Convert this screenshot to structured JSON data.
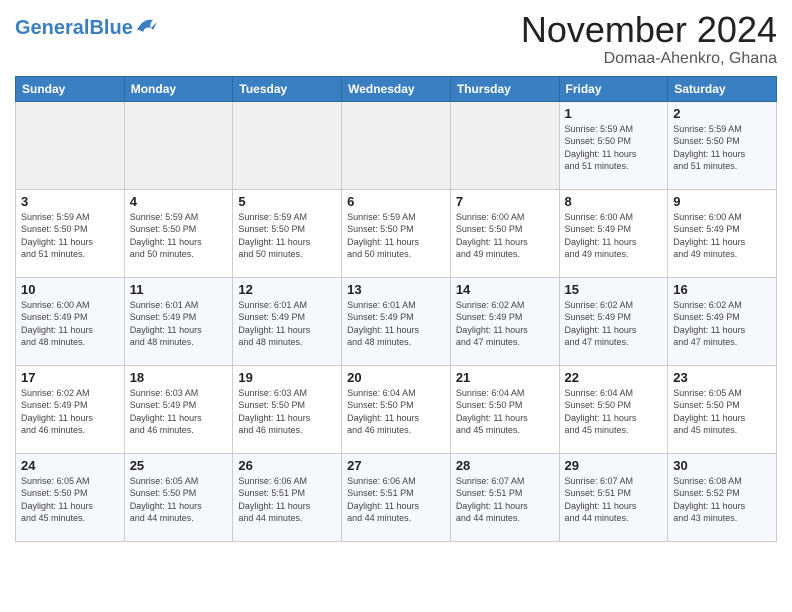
{
  "header": {
    "logo_general": "General",
    "logo_blue": "Blue",
    "month": "November 2024",
    "location": "Domaa-Ahenkro, Ghana"
  },
  "weekdays": [
    "Sunday",
    "Monday",
    "Tuesday",
    "Wednesday",
    "Thursday",
    "Friday",
    "Saturday"
  ],
  "weeks": [
    [
      {
        "day": "",
        "info": ""
      },
      {
        "day": "",
        "info": ""
      },
      {
        "day": "",
        "info": ""
      },
      {
        "day": "",
        "info": ""
      },
      {
        "day": "",
        "info": ""
      },
      {
        "day": "1",
        "info": "Sunrise: 5:59 AM\nSunset: 5:50 PM\nDaylight: 11 hours\nand 51 minutes."
      },
      {
        "day": "2",
        "info": "Sunrise: 5:59 AM\nSunset: 5:50 PM\nDaylight: 11 hours\nand 51 minutes."
      }
    ],
    [
      {
        "day": "3",
        "info": "Sunrise: 5:59 AM\nSunset: 5:50 PM\nDaylight: 11 hours\nand 51 minutes."
      },
      {
        "day": "4",
        "info": "Sunrise: 5:59 AM\nSunset: 5:50 PM\nDaylight: 11 hours\nand 50 minutes."
      },
      {
        "day": "5",
        "info": "Sunrise: 5:59 AM\nSunset: 5:50 PM\nDaylight: 11 hours\nand 50 minutes."
      },
      {
        "day": "6",
        "info": "Sunrise: 5:59 AM\nSunset: 5:50 PM\nDaylight: 11 hours\nand 50 minutes."
      },
      {
        "day": "7",
        "info": "Sunrise: 6:00 AM\nSunset: 5:50 PM\nDaylight: 11 hours\nand 49 minutes."
      },
      {
        "day": "8",
        "info": "Sunrise: 6:00 AM\nSunset: 5:49 PM\nDaylight: 11 hours\nand 49 minutes."
      },
      {
        "day": "9",
        "info": "Sunrise: 6:00 AM\nSunset: 5:49 PM\nDaylight: 11 hours\nand 49 minutes."
      }
    ],
    [
      {
        "day": "10",
        "info": "Sunrise: 6:00 AM\nSunset: 5:49 PM\nDaylight: 11 hours\nand 48 minutes."
      },
      {
        "day": "11",
        "info": "Sunrise: 6:01 AM\nSunset: 5:49 PM\nDaylight: 11 hours\nand 48 minutes."
      },
      {
        "day": "12",
        "info": "Sunrise: 6:01 AM\nSunset: 5:49 PM\nDaylight: 11 hours\nand 48 minutes."
      },
      {
        "day": "13",
        "info": "Sunrise: 6:01 AM\nSunset: 5:49 PM\nDaylight: 11 hours\nand 48 minutes."
      },
      {
        "day": "14",
        "info": "Sunrise: 6:02 AM\nSunset: 5:49 PM\nDaylight: 11 hours\nand 47 minutes."
      },
      {
        "day": "15",
        "info": "Sunrise: 6:02 AM\nSunset: 5:49 PM\nDaylight: 11 hours\nand 47 minutes."
      },
      {
        "day": "16",
        "info": "Sunrise: 6:02 AM\nSunset: 5:49 PM\nDaylight: 11 hours\nand 47 minutes."
      }
    ],
    [
      {
        "day": "17",
        "info": "Sunrise: 6:02 AM\nSunset: 5:49 PM\nDaylight: 11 hours\nand 46 minutes."
      },
      {
        "day": "18",
        "info": "Sunrise: 6:03 AM\nSunset: 5:49 PM\nDaylight: 11 hours\nand 46 minutes."
      },
      {
        "day": "19",
        "info": "Sunrise: 6:03 AM\nSunset: 5:50 PM\nDaylight: 11 hours\nand 46 minutes."
      },
      {
        "day": "20",
        "info": "Sunrise: 6:04 AM\nSunset: 5:50 PM\nDaylight: 11 hours\nand 46 minutes."
      },
      {
        "day": "21",
        "info": "Sunrise: 6:04 AM\nSunset: 5:50 PM\nDaylight: 11 hours\nand 45 minutes."
      },
      {
        "day": "22",
        "info": "Sunrise: 6:04 AM\nSunset: 5:50 PM\nDaylight: 11 hours\nand 45 minutes."
      },
      {
        "day": "23",
        "info": "Sunrise: 6:05 AM\nSunset: 5:50 PM\nDaylight: 11 hours\nand 45 minutes."
      }
    ],
    [
      {
        "day": "24",
        "info": "Sunrise: 6:05 AM\nSunset: 5:50 PM\nDaylight: 11 hours\nand 45 minutes."
      },
      {
        "day": "25",
        "info": "Sunrise: 6:05 AM\nSunset: 5:50 PM\nDaylight: 11 hours\nand 44 minutes."
      },
      {
        "day": "26",
        "info": "Sunrise: 6:06 AM\nSunset: 5:51 PM\nDaylight: 11 hours\nand 44 minutes."
      },
      {
        "day": "27",
        "info": "Sunrise: 6:06 AM\nSunset: 5:51 PM\nDaylight: 11 hours\nand 44 minutes."
      },
      {
        "day": "28",
        "info": "Sunrise: 6:07 AM\nSunset: 5:51 PM\nDaylight: 11 hours\nand 44 minutes."
      },
      {
        "day": "29",
        "info": "Sunrise: 6:07 AM\nSunset: 5:51 PM\nDaylight: 11 hours\nand 44 minutes."
      },
      {
        "day": "30",
        "info": "Sunrise: 6:08 AM\nSunset: 5:52 PM\nDaylight: 11 hours\nand 43 minutes."
      }
    ]
  ]
}
